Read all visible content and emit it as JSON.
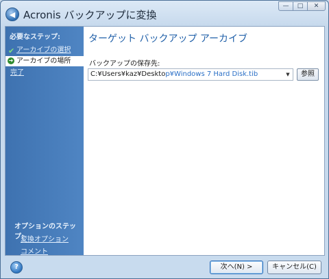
{
  "window": {
    "title": "Acronis バックアップに変換",
    "controls": {
      "minimize": "—",
      "maximize": "□",
      "close": "✕"
    }
  },
  "sidebar": {
    "required_steps_header": "必要なステップ:",
    "steps": [
      {
        "label": "アーカイブの選択",
        "state": "done"
      },
      {
        "label": "アーカイブの場所",
        "state": "current"
      },
      {
        "label": "完了",
        "state": "pending"
      }
    ],
    "optional_steps_header": "オプションのステップ:",
    "optional_links": [
      "変換オプション",
      "コメント"
    ]
  },
  "main": {
    "title": "ターゲット バックアップ アーカイブ",
    "location_label": "バックアップの保存先:",
    "location_value_plain": "C:¥Users¥kaz¥Deskto",
    "location_value_highlight": "p¥Windows 7 Hard Disk.tib",
    "browse_label": "参照"
  },
  "footer": {
    "next_label": "次へ(N) >",
    "cancel_label": "キャンセル(C)"
  },
  "colors": {
    "sidebar": "#4a7fbf",
    "title_accent": "#1f5fa8",
    "highlight_text": "#2a6fc6"
  }
}
